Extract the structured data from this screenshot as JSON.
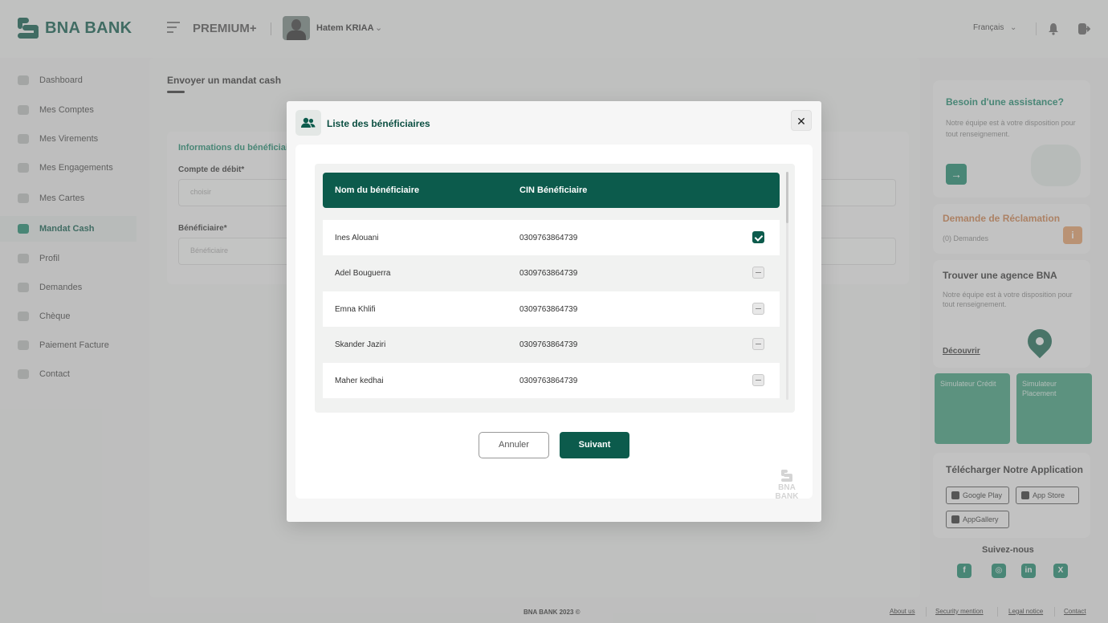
{
  "app": {
    "logo_text": "BNA BANK",
    "tier": "PREMIUM+",
    "user_name": "Hatem KRIAA",
    "language": "Français"
  },
  "sidebar": {
    "items": [
      {
        "label": "Dashboard",
        "icon": "dashboard-icon"
      },
      {
        "label": "Mes Comptes",
        "icon": "folder-icon"
      },
      {
        "label": "Mes Virements",
        "icon": "transfer-icon"
      },
      {
        "label": "Mes Engagements",
        "icon": "engagement-icon"
      },
      {
        "label": "Mes Cartes",
        "icon": "card-icon"
      },
      {
        "label": "Mandat Cash",
        "icon": "mail-icon",
        "active": true
      },
      {
        "label": "Profil",
        "icon": "user-icon"
      },
      {
        "label": "Demandes",
        "icon": "request-icon"
      },
      {
        "label": "Chèque",
        "icon": "cheque-icon"
      },
      {
        "label": "Paiement Facture",
        "icon": "invoice-icon"
      },
      {
        "label": "Contact",
        "icon": "phone-icon"
      }
    ]
  },
  "page": {
    "title": "Envoyer un mandat cash",
    "section_title": "Informations du bénéficiaire",
    "debit_label": "Compte de débit*",
    "debit_placeholder": "choisir",
    "beneficiary_label": "Bénéficiaire*",
    "beneficiary_placeholder": "Bénéficiaire"
  },
  "right_panel": {
    "assist_title": "Besoin d'une assistance?",
    "assist_text": "Notre équipe est à votre disposition pour tout renseignement.",
    "reclamation_title": "Demande de Réclamation",
    "reclamation_count": "(0) Demandes",
    "agence_title": "Trouver une agence BNA",
    "agence_text": "Notre équipe est à votre disposition pour tout renseignement.",
    "discover_label": "Découvrir",
    "sim_credit": "Simulateur Crédit",
    "sim_placement": "Simulateur Placement",
    "app_title": "Télécharger Notre Application",
    "stores": [
      "Google Play",
      "App Store",
      "AppGallery"
    ],
    "follow_title": "Suivez-nous"
  },
  "modal": {
    "title": "Liste des bénéficiaires",
    "columns": [
      "Nom du bénéficiaire",
      "CIN Bénéficiaire"
    ],
    "rows": [
      {
        "name": "Ines Alouani",
        "cin": "0309763864739",
        "checked": true
      },
      {
        "name": "Adel Bouguerra",
        "cin": "0309763864739",
        "checked": false
      },
      {
        "name": "Emna Khlifi",
        "cin": "0309763864739",
        "checked": false
      },
      {
        "name": "Skander Jaziri",
        "cin": "0309763864739",
        "checked": false
      },
      {
        "name": "Maher kedhai",
        "cin": "0309763864739",
        "checked": false
      }
    ],
    "cancel_label": "Annuler",
    "next_label": "Suivant",
    "watermark": "BNA BANK"
  },
  "footer": {
    "copyright": "BNA BANK 2023 ©",
    "links": [
      "About us",
      "Security mention",
      "Legal notice",
      "Contact"
    ]
  },
  "colors": {
    "primary": "#0c5b4c",
    "accent": "#1d8a6e",
    "warning": "#d0824d"
  }
}
